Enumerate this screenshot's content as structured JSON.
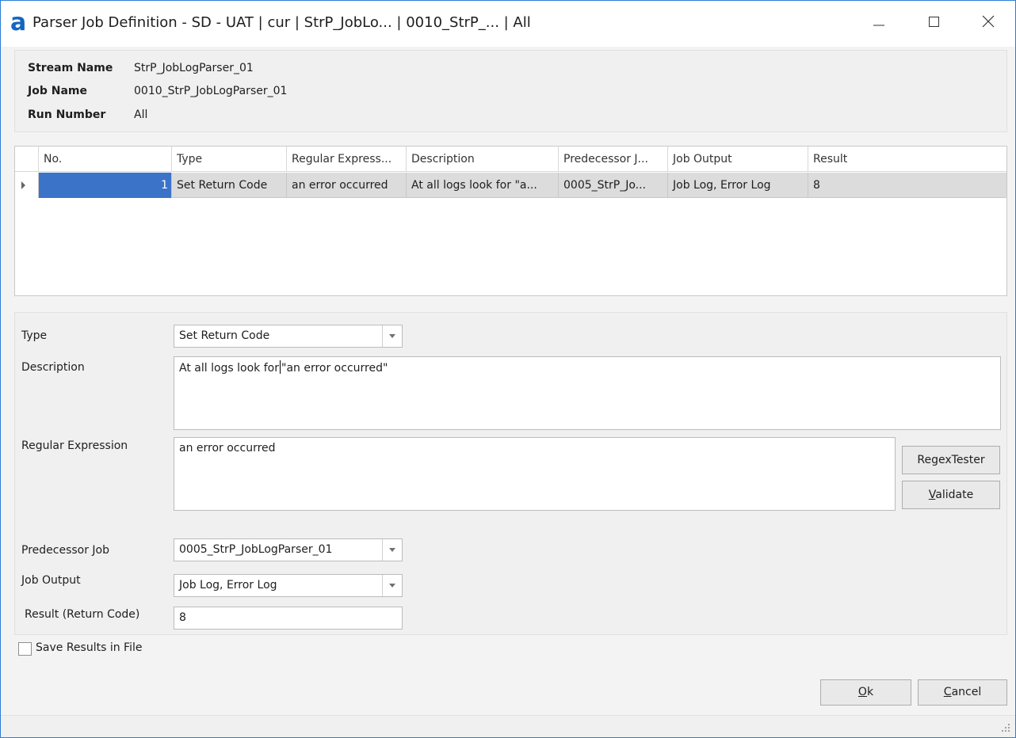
{
  "window": {
    "logo": "a",
    "title": "Parser Job Definition - SD - UAT | cur | StrP_JobLo... | 0010_StrP_... | All"
  },
  "info": {
    "stream_name_label": "Stream Name",
    "stream_name_value": "StrP_JobLogParser_01",
    "job_name_label": "Job Name",
    "job_name_value": "0010_StrP_JobLogParser_01",
    "run_number_label": "Run Number",
    "run_number_value": "All"
  },
  "grid": {
    "columns": [
      "No.",
      "Type",
      "Regular Express...",
      "Description",
      "Predecessor J...",
      "Job Output",
      "Result"
    ],
    "rows": [
      [
        "1",
        "Set Return Code",
        "an error occurred",
        "At all logs look for \"a...",
        "0005_StrP_Jo...",
        "Job Log, Error Log",
        "8"
      ]
    ]
  },
  "form": {
    "type_label": "Type",
    "type_value": "Set Return Code",
    "description_label": "Description",
    "description_before_caret": "At all logs look for",
    "description_after_caret": "\"an error occurred\"",
    "regex_label": "Regular Expression",
    "regex_value": "an error occurred",
    "regex_tester_label": "RegexTester",
    "validate_label_first": "V",
    "validate_label_rest": "alidate",
    "predecessor_label": "Predecessor Job",
    "predecessor_value": "0005_StrP_JobLogParser_01",
    "job_output_label": "Job Output",
    "job_output_value": "Job Log, Error Log",
    "result_label": "Result (Return Code)",
    "result_value": "8"
  },
  "save_results_label": "Save Results in File",
  "buttons": {
    "ok_first": "O",
    "ok_rest": "k",
    "cancel_first": "C",
    "cancel_rest": "ancel"
  },
  "colors": {
    "accent": "#2b7ed6",
    "selected_cell": "#3b73c9",
    "row_highlight": "#dcdcdc"
  }
}
